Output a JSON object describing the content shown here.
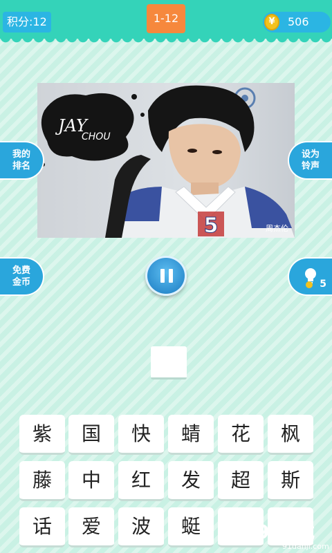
{
  "header": {
    "score": "积分:12",
    "level": "1-12",
    "coins": "506",
    "coin_symbol": "¥"
  },
  "photo": {
    "logo_line1": "JAY",
    "logo_line2": "CHOU",
    "shirt_number": "5",
    "watermark": "周杰伦"
  },
  "side": {
    "rank": "我的排名",
    "ringtone": "设为铃声",
    "free_coins": "免费金币",
    "hint_count": "5"
  },
  "keyboard": {
    "rows": [
      [
        "紫",
        "国",
        "快",
        "蜻",
        "花",
        "枫"
      ],
      [
        "藤",
        "中",
        "红",
        "发",
        "超",
        "斯"
      ],
      [
        "话",
        "爱",
        "波",
        "蜓",
        "",
        ""
      ]
    ]
  },
  "watermark": {
    "brand": "9l游戏",
    "url": "91danji.com"
  },
  "colors": {
    "topbar": "#34d3b9",
    "accent_blue": "#2bb5e3",
    "level_orange": "#f6883d",
    "background": "#c9f1e4"
  }
}
